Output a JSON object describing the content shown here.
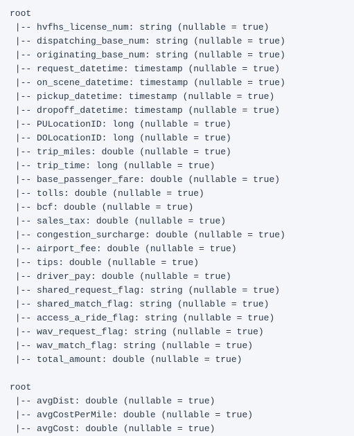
{
  "schemas": [
    {
      "root_label": "root",
      "prefix": " |-- ",
      "fields": [
        {
          "text": "hvfhs_license_num: string (nullable = true)"
        },
        {
          "text": "dispatching_base_num: string (nullable = true)"
        },
        {
          "text": "originating_base_num: string (nullable = true)"
        },
        {
          "text": "request_datetime: timestamp (nullable = true)"
        },
        {
          "text": "on_scene_datetime: timestamp (nullable = true)"
        },
        {
          "text": "pickup_datetime: timestamp (nullable = true)"
        },
        {
          "text": "dropoff_datetime: timestamp (nullable = true)"
        },
        {
          "text": "PULocationID: long (nullable = true)"
        },
        {
          "text": "DOLocationID: long (nullable = true)"
        },
        {
          "text": "trip_miles: double (nullable = true)"
        },
        {
          "text": "trip_time: long (nullable = true)"
        },
        {
          "text": "base_passenger_fare: double (nullable = true)"
        },
        {
          "text": "tolls: double (nullable = true)"
        },
        {
          "text": "bcf: double (nullable = true)"
        },
        {
          "text": "sales_tax: double (nullable = true)"
        },
        {
          "text": "congestion_surcharge: double (nullable = true)"
        },
        {
          "text": "airport_fee: double (nullable = true)"
        },
        {
          "text": "tips: double (nullable = true)"
        },
        {
          "text": "driver_pay: double (nullable = true)"
        },
        {
          "text": "shared_request_flag: string (nullable = true)"
        },
        {
          "text": "shared_match_flag: string (nullable = true)"
        },
        {
          "text": "access_a_ride_flag: string (nullable = true)"
        },
        {
          "text": "wav_request_flag: string (nullable = true)"
        },
        {
          "text": "wav_match_flag: string (nullable = true)"
        },
        {
          "text": "total_amount: double (nullable = true)"
        }
      ]
    },
    {
      "root_label": "root",
      "prefix": " |-- ",
      "fields": [
        {
          "text": "avgDist: double (nullable = true)"
        },
        {
          "text": "avgCostPerMile: double (nullable = true)"
        },
        {
          "text": "avgCost: double (nullable = true)"
        }
      ]
    }
  ]
}
